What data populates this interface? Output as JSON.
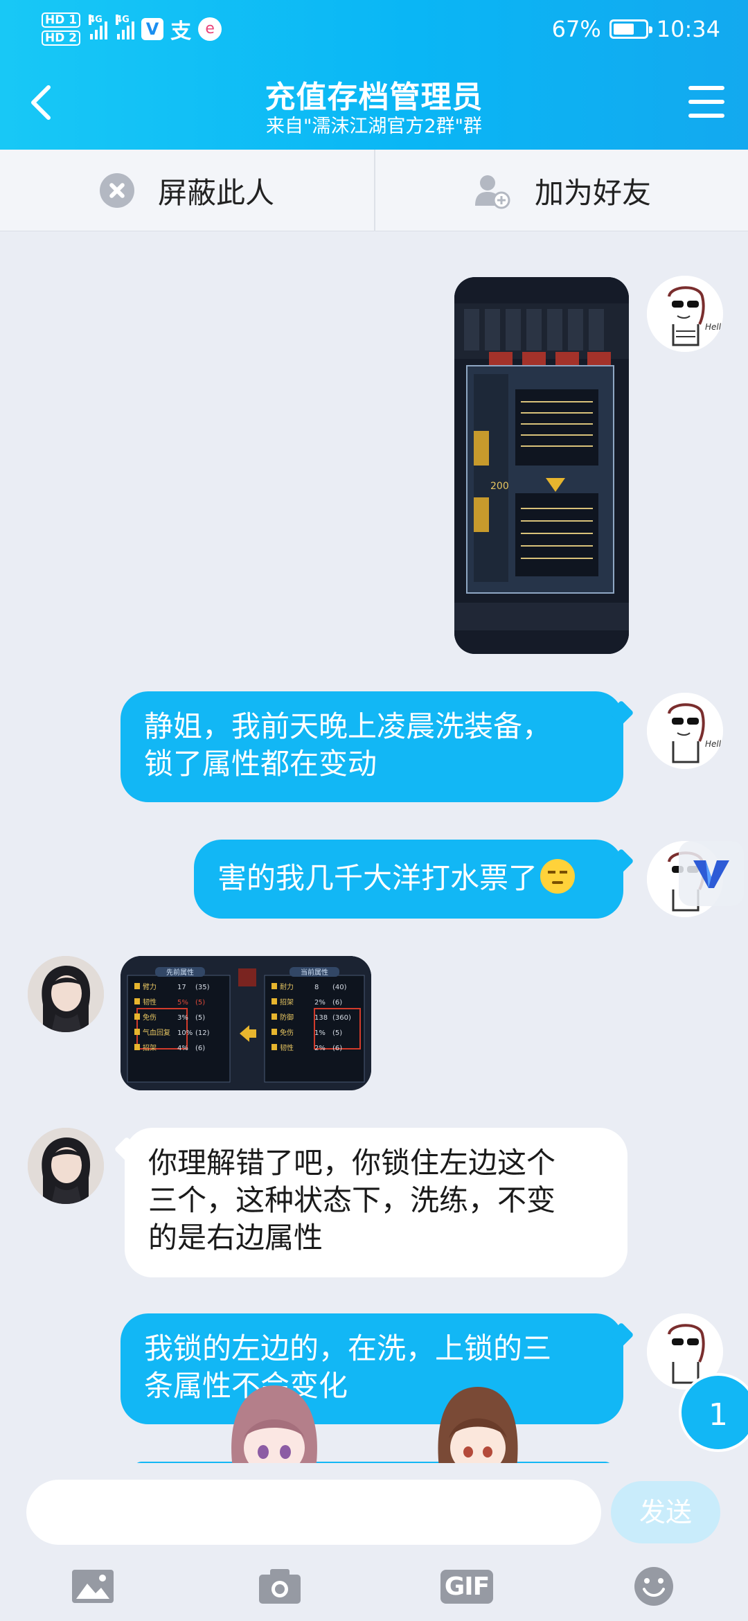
{
  "status_bar": {
    "hd1": "HD 1",
    "hd2": "HD 2",
    "net1": "4G",
    "net2": "4G",
    "alipay": "支",
    "battery": "67%",
    "battery_level": 0.67,
    "time": "10:34"
  },
  "header": {
    "title": "充值存档管理员",
    "subtitle": "来自\"濡沫江湖官方2群\"群"
  },
  "actions": {
    "block": "屏蔽此人",
    "add_friend": "加为好友"
  },
  "messages": [
    {
      "from": "me",
      "type": "image"
    },
    {
      "from": "me",
      "type": "text",
      "line1": "静姐，我前天晚上凌晨洗装备，",
      "line2": "锁了属性都在变动"
    },
    {
      "from": "me",
      "type": "text",
      "text": "害的我几千大洋打水票了"
    },
    {
      "from": "her",
      "type": "image"
    },
    {
      "from": "her",
      "type": "text",
      "line1": "你理解错了吧，你锁住左边这个",
      "line2": "三个，这种状态下，洗练，不变",
      "line3": "的是右边属性"
    },
    {
      "from": "me",
      "type": "text",
      "line1": "我锁的左边的，在洗，上锁的三",
      "line2": "条属性不会变化"
    }
  ],
  "screenshot_mini": {
    "left_panel_title": "先前属性",
    "right_panel_title": "当前属性",
    "left_rows": [
      {
        "name": "臂力",
        "val": "17",
        "max": "(35)"
      },
      {
        "name": "韧性",
        "val": "5%",
        "max": "(5)"
      },
      {
        "name": "免伤",
        "val": "3%",
        "max": "(5)"
      },
      {
        "name": "气血回复",
        "val": "10%",
        "max": "(12)"
      },
      {
        "name": "招架",
        "val": "4%",
        "max": "(6)"
      }
    ],
    "right_rows": [
      {
        "name": "耐力",
        "val": "8",
        "max": "(40)"
      },
      {
        "name": "招架",
        "val": "2%",
        "max": "(6)"
      },
      {
        "name": "防御",
        "val": "138",
        "max": "(360)"
      },
      {
        "name": "免伤",
        "val": "1%",
        "max": "(5)"
      },
      {
        "name": "韧性",
        "val": "2%",
        "max": "(6)"
      }
    ],
    "cost": "200"
  },
  "unread_count": "1",
  "input": {
    "placeholder": "",
    "send": "发送"
  },
  "toolbar": {
    "gif": "GIF"
  },
  "colors": {
    "accent": "#12b7f5",
    "send_disabled": "#c9ecfb",
    "background": "#eaedf4"
  }
}
